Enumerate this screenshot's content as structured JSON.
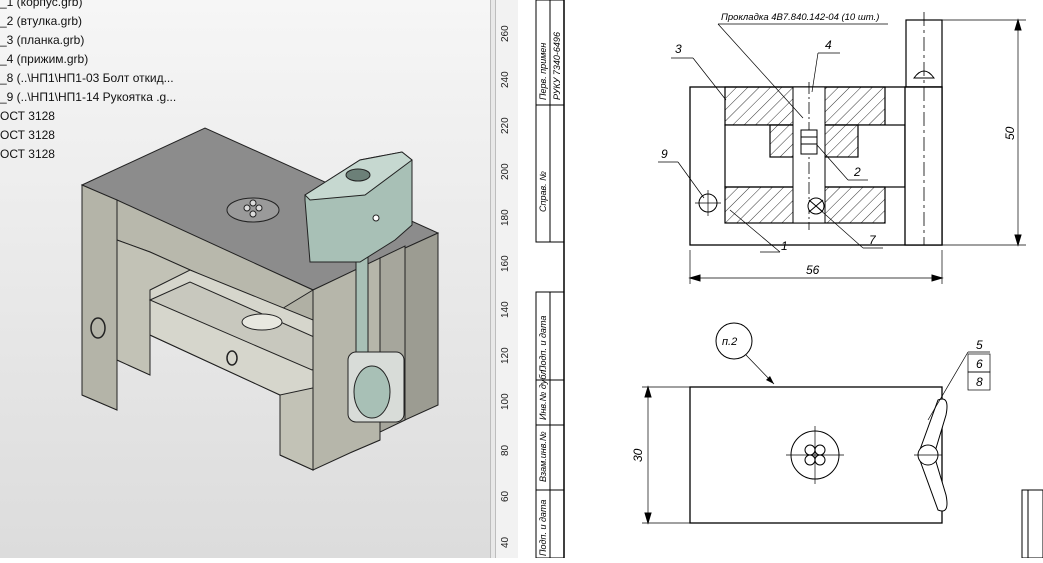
{
  "tree": {
    "items": [
      "_1 (корпус.grb)",
      "_2 (втулка.grb)",
      "_3 (планка.grb)",
      "_4 (прижим.grb)",
      "_8 (..\\НП1\\НП1-03 Болт откид...",
      "_9 (..\\НП1\\НП1-14 Рукоятка .g...",
      "ОСТ 3128",
      "ОСТ 3128",
      "ОСТ 3128"
    ]
  },
  "ruler": {
    "labels": [
      "260",
      "240",
      "220",
      "200",
      "180",
      "160",
      "140",
      "120",
      "100",
      "80",
      "60",
      "40"
    ]
  },
  "drawing": {
    "stamp_labels": {
      "perv_primen": "Перв. примен",
      "perv_primen_value": "РУКУ 7340-6496",
      "sprav": "Справ. №",
      "podp_data_1": "Подп. и дата",
      "inv_dubl": "Инв.№ дубл.",
      "vzam_inv": "Взам.инв.№",
      "podp_data_2": "Подп. и дата"
    },
    "leader_note": "Прокладка 4В7.840.142-04 (10 шт.)",
    "dimensions": {
      "width": "56",
      "height": "50",
      "plan_height": "30"
    },
    "positions": {
      "p1": "1",
      "p2": "2",
      "p3": "3",
      "p4": "4",
      "p5": "5",
      "p6": "6",
      "p7": "7",
      "p8": "8",
      "p9": "9"
    },
    "note_bubble": "п.2"
  },
  "colors": {
    "model_face_top": "#8a8a8a",
    "model_face_front": "#b8b8ac",
    "model_face_side": "#9c9c92",
    "handle": "#a8c0b6",
    "line": "#000000"
  }
}
